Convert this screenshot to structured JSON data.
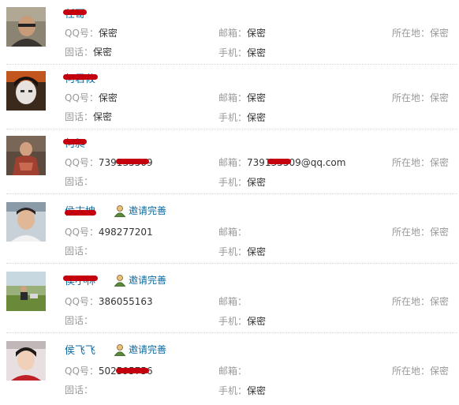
{
  "labels": {
    "qq": "QQ号：",
    "email": "邮箱：",
    "location": "所在地：",
    "landline": "固话：",
    "mobile": "手机："
  },
  "invite_label": "邀请完善",
  "redaction_color": "#c4000e",
  "link_color": "#0a6aa1",
  "contacts": [
    {
      "name": "任哥",
      "qq": "保密",
      "email": "保密",
      "location": "保密",
      "landline": "保密",
      "mobile": "保密"
    },
    {
      "name": "何君莜",
      "qq": "保密",
      "email": "保密",
      "location": "保密",
      "landline": "保密",
      "mobile": "保密"
    },
    {
      "name": "何昶",
      "qq": "739135509",
      "email": "739135509@qq.com",
      "location": "保密",
      "landline": "",
      "mobile": "保密"
    },
    {
      "name": "侯志坤",
      "qq": "498277201",
      "email": "",
      "location": "保密",
      "landline": "",
      "mobile": "保密",
      "invite": true
    },
    {
      "name": "侯小林",
      "qq": "386055163",
      "email": "",
      "location": "保密",
      "landline": "",
      "mobile": "保密",
      "invite": true
    },
    {
      "name": "侯飞飞",
      "qq": "502595756",
      "email": "",
      "location": "保密",
      "landline": "",
      "mobile": "保密",
      "invite": true
    }
  ]
}
